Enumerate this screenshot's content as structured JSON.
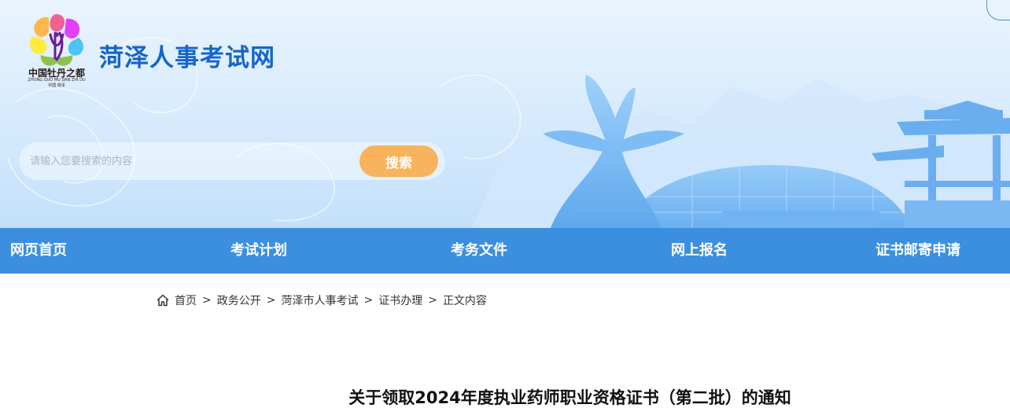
{
  "header": {
    "site_title": "菏泽人事考试网",
    "logo_caption": "中国牡丹之都",
    "logo_sub_en": "ZHONG GUO MU DAN ZHI DU",
    "logo_sub_cn": "中国·菏泽"
  },
  "search": {
    "placeholder": "请输入您要搜索的内容",
    "value": "",
    "button_label": "搜索"
  },
  "nav": {
    "items": [
      {
        "label": "网页首页"
      },
      {
        "label": "考试计划"
      },
      {
        "label": "考务文件"
      },
      {
        "label": "网上报名"
      },
      {
        "label": "证书邮寄申请"
      }
    ]
  },
  "breadcrumb": {
    "items": [
      "首页",
      "政务公开",
      "菏泽市人事考试",
      "证书办理",
      "正文内容"
    ],
    "separator": ">"
  },
  "article": {
    "title": "关于领取2024年度执业药师职业资格证书（第二批）的通知"
  },
  "colors": {
    "brand_blue": "#1565c8",
    "nav_blue": "#3b8fde",
    "search_button": "#f8b35c"
  },
  "icons": {
    "home": "home-icon",
    "logo": "peony-logo-icon"
  }
}
